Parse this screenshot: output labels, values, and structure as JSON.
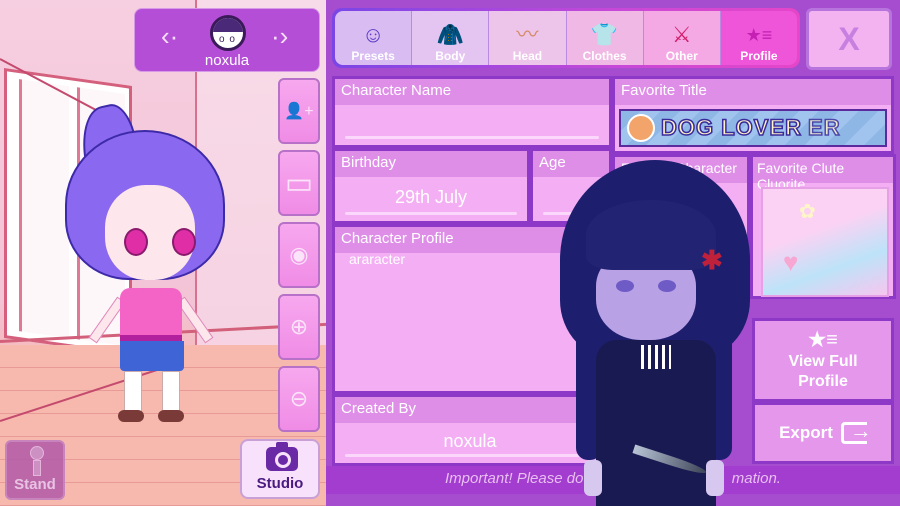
{
  "scene": {
    "selector": {
      "prev_icon": "chevron-left-icon",
      "next_icon": "chevron-right-icon",
      "character_name": "noxula"
    },
    "tools": [
      {
        "name": "add-character",
        "icon": "add-person-icon",
        "glyph": "👤+"
      },
      {
        "name": "background",
        "icon": "image-icon",
        "glyph": "▭"
      },
      {
        "name": "visibility",
        "icon": "eye-icon",
        "glyph": "◉"
      },
      {
        "name": "zoom-in",
        "icon": "zoom-in-icon",
        "glyph": "⊕"
      },
      {
        "name": "zoom-out",
        "icon": "zoom-out-icon",
        "glyph": "⊖"
      }
    ],
    "stand_label": "Stand",
    "studio_label": "Studio"
  },
  "tabs": [
    {
      "label": "Presets",
      "icon": "person-outline-icon",
      "glyph": "☺"
    },
    {
      "label": "Body",
      "icon": "jacket-icon",
      "glyph": "🧥"
    },
    {
      "label": "Head",
      "icon": "hair-icon",
      "glyph": "〰"
    },
    {
      "label": "Clothes",
      "icon": "tshirt-icon",
      "glyph": "👕"
    },
    {
      "label": "Other",
      "icon": "sword-cat-icon",
      "glyph": "⚔"
    },
    {
      "label": "Profile",
      "icon": "star-list-icon",
      "glyph": "★≡"
    }
  ],
  "active_tab": "Profile",
  "close_label": "X",
  "profile": {
    "character_name": {
      "label": "Character Name",
      "value": ""
    },
    "birthday": {
      "label": "Birthday",
      "value": "29th July"
    },
    "age": {
      "label": "Age",
      "value": ""
    },
    "character_profile": {
      "label": "Character Profile",
      "value": "araracter"
    },
    "created_by": {
      "label": "Created By",
      "value": "noxula"
    },
    "favorite_title": {
      "label": "Favorite Title",
      "value": "DOG LOVER",
      "suffix": "ER"
    },
    "favorite_character": {
      "label": "Favorite Character"
    },
    "favorite_cute": {
      "label": "Favorite Clute Cluorite"
    }
  },
  "actions": {
    "view_full_profile": {
      "label_line1": "View Full",
      "label_line2": "Profile",
      "icon": "★≡"
    },
    "export": {
      "label": "Export"
    }
  },
  "notice": {
    "left": "Important! Please do",
    "right": "mation."
  },
  "colors": {
    "panel_bg": "#a54ccf",
    "field_bg": "#f4aef4",
    "field_head": "#df8ee8",
    "active_tab": "#ee55d8",
    "accent_purple": "#8d38c7"
  }
}
